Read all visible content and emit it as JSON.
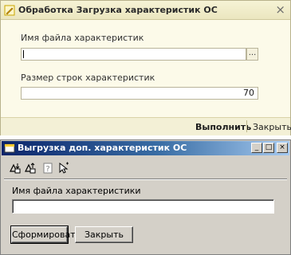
{
  "window1": {
    "title": "Обработка  Загрузка характеристик ОС",
    "close_glyph": "×",
    "file_label": "Имя файла характеристик",
    "file_value": "",
    "browse_label": "...",
    "rows_label": "Размер строк характеристик",
    "rows_value": "70",
    "execute_label": "Выполнить",
    "close_label": "Закрыть"
  },
  "window2": {
    "title": "Выгрузка доп. характеристик ОС",
    "minimize_glyph": "_",
    "maximize_glyph": "□",
    "close_glyph": "×",
    "toolbar_icons": [
      "save-icon",
      "load-icon",
      "help-icon",
      "select-cursor-icon"
    ],
    "file_label": "Имя файла характеристики",
    "file_value": "",
    "form_button": "Сформировать",
    "close_button": "Закрыть"
  },
  "colors": {
    "w1_background": "#fcfae9",
    "w2_title_start": "#0a246a",
    "w2_title_end": "#a6caf0",
    "w2_face": "#d4d0c8"
  }
}
